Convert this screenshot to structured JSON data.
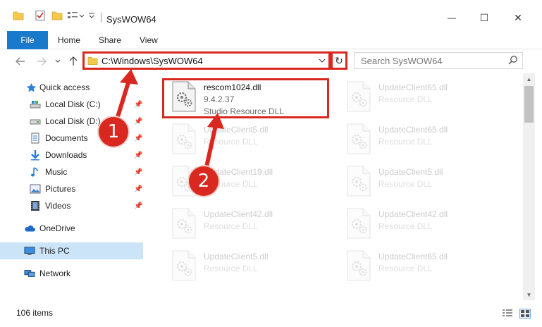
{
  "window": {
    "title": "SysWOW64",
    "minimize_glyph": "—",
    "maximize_glyph": "☐",
    "close_glyph": "✕"
  },
  "ribbon": {
    "file": "File",
    "tabs": [
      "Home",
      "Share",
      "View"
    ]
  },
  "address": {
    "path": "C:\\Windows\\SysWOW64",
    "refresh_glyph": "↻"
  },
  "search": {
    "placeholder": "Search SysWOW64"
  },
  "sidebar": {
    "items": [
      {
        "label": "Quick access",
        "icon": "star-icon",
        "pinned": false
      },
      {
        "label": "Local Disk (C:)",
        "icon": "drive-icon",
        "pinned": true
      },
      {
        "label": "Local Disk (D:)",
        "icon": "drive-icon",
        "pinned": true
      },
      {
        "label": "Documents",
        "icon": "documents-icon",
        "pinned": true
      },
      {
        "label": "Downloads",
        "icon": "download-icon",
        "pinned": true
      },
      {
        "label": "Music",
        "icon": "music-icon",
        "pinned": true
      },
      {
        "label": "Pictures",
        "icon": "pictures-icon",
        "pinned": true
      },
      {
        "label": "Videos",
        "icon": "videos-icon",
        "pinned": true
      },
      {
        "label": "OneDrive",
        "icon": "cloud-icon",
        "pinned": false
      },
      {
        "label": "This PC",
        "icon": "computer-icon",
        "pinned": false,
        "selected": true
      },
      {
        "label": "Network",
        "icon": "network-icon",
        "pinned": false
      }
    ]
  },
  "files": [
    {
      "name": "rescom1024.dll",
      "version": "9.4.2.37",
      "desc": "Studio Resource DLL",
      "faded": false
    },
    {
      "name": "UpdateClient65.dll",
      "version": "",
      "desc": "Resource DLL",
      "faded": true
    },
    {
      "name": "UpdateClient5.dll",
      "version": "",
      "desc": "Resource DLL",
      "faded": true
    },
    {
      "name": "UpdateClient65.dll",
      "version": "",
      "desc": "Resource DLL",
      "faded": true
    },
    {
      "name": "UpdateClient19.dll",
      "version": "",
      "desc": "Resource DLL",
      "faded": true
    },
    {
      "name": "UpdateClient5.dll",
      "version": "",
      "desc": "Resource DLL",
      "faded": true
    },
    {
      "name": "UpdateClient42.dll",
      "version": "",
      "desc": "Resource DLL",
      "faded": true
    },
    {
      "name": "UpdateClient42.dll",
      "version": "",
      "desc": "Resource DLL",
      "faded": true
    },
    {
      "name": "UpdateClient5.dll",
      "version": "",
      "desc": "Resource DLL",
      "faded": true
    },
    {
      "name": "UpdateClient65.dll",
      "version": "",
      "desc": "Resource DLL",
      "faded": true
    }
  ],
  "status": {
    "count": "106 items"
  },
  "annotations": {
    "badge1": "1",
    "badge2": "2",
    "color": "#d9281f"
  }
}
